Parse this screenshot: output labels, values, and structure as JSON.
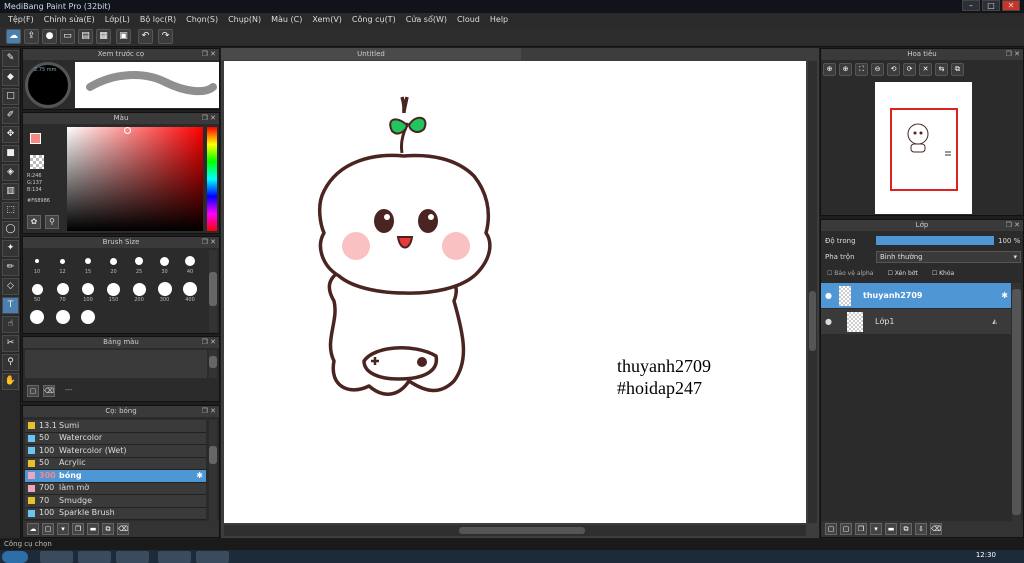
{
  "app": {
    "title": "MediBang Paint Pro (32bit)"
  },
  "window_controls": {
    "minimize": "–",
    "maximize": "□",
    "close": "✕"
  },
  "menu": [
    "Tệp(F)",
    "Chỉnh sửa(E)",
    "Lớp(L)",
    "Bộ lọc(R)",
    "Chọn(S)",
    "Chụp(N)",
    "Màu (C)",
    "Xem(V)",
    "Công cụ(T)",
    "Cửa sổ(W)",
    "Cloud",
    "Help"
  ],
  "panels": {
    "brush_preview": {
      "title": "Xem trước cọ",
      "size_label": "2.75 mm"
    },
    "color": {
      "title": "Màu",
      "r": "R:246",
      "g": "G:137",
      "b": "B:134",
      "hex": "#F68986",
      "fg": "#f68986",
      "bg": "#22c55e"
    },
    "brush_size": {
      "title": "Brush Size",
      "sizes": [
        "10",
        "12",
        "15",
        "20",
        "25",
        "30",
        "40",
        "50",
        "70",
        "100",
        "150",
        "200",
        "300",
        "400",
        "",
        "",
        ""
      ]
    },
    "palette": {
      "title": "Bảng màu",
      "placeholder": "---"
    },
    "brush": {
      "title": "Cọ: bóng",
      "items": [
        {
          "size": "13.1",
          "name": "Sumi",
          "color": "#e6c229"
        },
        {
          "size": "50",
          "name": "Watercolor",
          "color": "#6ac5f1"
        },
        {
          "size": "100",
          "name": "Watercolor (Wet)",
          "color": "#6ac5f1"
        },
        {
          "size": "50",
          "name": "Acrylic",
          "color": "#e6c229"
        },
        {
          "size": "300",
          "name": "bóng",
          "color": "#f1a5c0"
        },
        {
          "size": "700",
          "name": "làm mờ",
          "color": "#f1a5c0"
        },
        {
          "size": "70",
          "name": "Smudge",
          "color": "#e6c229"
        },
        {
          "size": "100",
          "name": "Sparkle Brush",
          "color": "#6ac5f1"
        }
      ]
    },
    "navigator": {
      "title": "Hoa tiêu"
    },
    "layers": {
      "title": "Lớp",
      "opacity_label": "Độ trong",
      "opacity_value": "100 %",
      "opacity": 1.0,
      "blend_label": "Pha trộn",
      "blend_value": "Bình thường",
      "check_alpha": "Bảo vệ alpha",
      "check_clip": "Xén bớt",
      "check_lock": "Khóa",
      "items": [
        {
          "name": "thuyanh2709",
          "selected": true
        },
        {
          "name": "Lớp1",
          "selected": false
        }
      ]
    }
  },
  "canvas": {
    "tab": "Untitled",
    "text_line1": "thuyanh2709",
    "text_line2": "#hoidap247"
  },
  "status": {
    "text": "Công cụ chọn"
  },
  "taskbar": {
    "clock": "12:30"
  }
}
